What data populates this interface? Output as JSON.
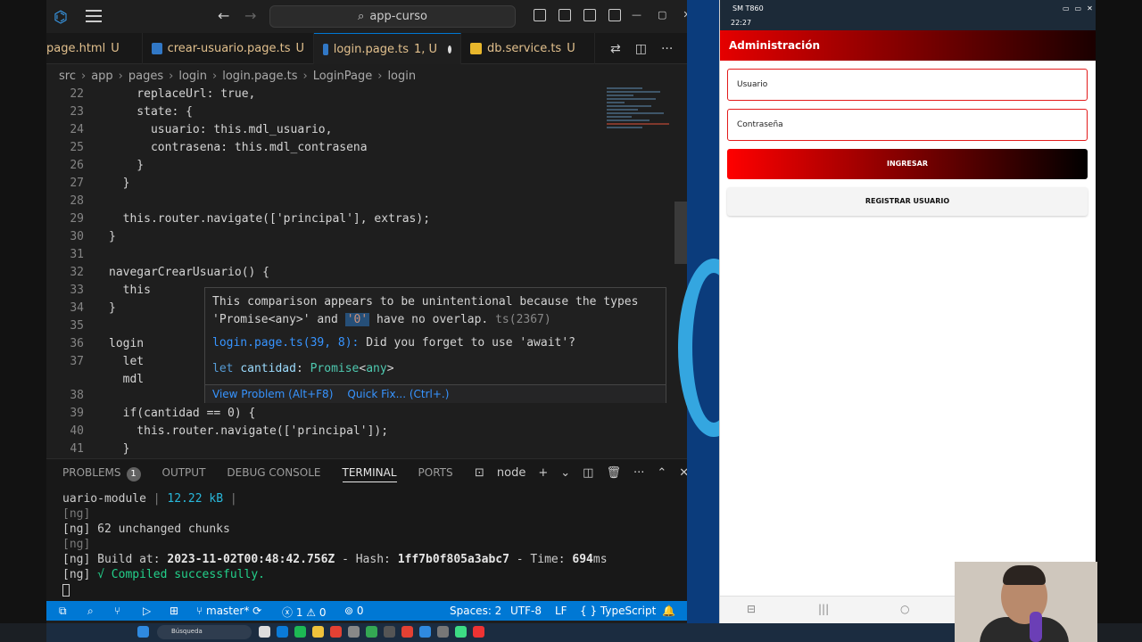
{
  "titlebar": {
    "search": "app-curso"
  },
  "tabs": [
    {
      "label": "page.html",
      "suffix": "U",
      "kind": "html"
    },
    {
      "label": "crear-usuario.page.ts",
      "suffix": "U",
      "kind": "ts"
    },
    {
      "label": "login.page.ts",
      "suffix": "1, U",
      "kind": "ts",
      "active": true
    },
    {
      "label": "db.service.ts",
      "suffix": "U",
      "kind": "ng"
    }
  ],
  "breadcrumb": [
    "src",
    "app",
    "pages",
    "login",
    "login.page.ts",
    "LoginPage",
    "login"
  ],
  "code_lines": [
    {
      "n": "22",
      "text": "    replaceUrl: true,"
    },
    {
      "n": "23",
      "text": "    state: {"
    },
    {
      "n": "24",
      "text": "      usuario: this.mdl_usuario,"
    },
    {
      "n": "25",
      "text": "      contrasena: this.mdl_contrasena"
    },
    {
      "n": "26",
      "text": "    }"
    },
    {
      "n": "27",
      "text": "  }"
    },
    {
      "n": "28",
      "text": ""
    },
    {
      "n": "29",
      "text": "  this.router.navigate(['principal'], extras);"
    },
    {
      "n": "30",
      "text": "}"
    },
    {
      "n": "31",
      "text": ""
    },
    {
      "n": "32",
      "text": "navegarCrearUsuario() {"
    },
    {
      "n": "33",
      "text": "  this"
    },
    {
      "n": "34",
      "text": "}"
    },
    {
      "n": "35",
      "text": ""
    },
    {
      "n": "36",
      "text": "login"
    },
    {
      "n": "37",
      "text": "  let"
    },
    {
      "n": "",
      "text": "  mdl"
    },
    {
      "n": "38",
      "text": ""
    },
    {
      "n": "39",
      "text": "  if(cantidad == 0) {"
    },
    {
      "n": "40",
      "text": "    this.router.navigate(['principal']);"
    },
    {
      "n": "41",
      "text": "  }"
    }
  ],
  "hover": {
    "line1": "This comparison appears to be unintentional because the types",
    "line2_a": "'Promise<any>' and ",
    "line2_hl": "'0'",
    "line2_b": " have no overlap.",
    "code": "ts(2367)",
    "related_link": "login.page.ts(39, 8):",
    "related_text": " Did you forget to use 'await'?",
    "signature": "let cantidad: Promise<any>",
    "view_problem": "View Problem (Alt+F8)",
    "quick_fix": "Quick Fix... (Ctrl+.)"
  },
  "panel": {
    "tabs": [
      "PROBLEMS",
      "OUTPUT",
      "DEBUG CONSOLE",
      "TERMINAL",
      "PORTS"
    ],
    "problems_count": "1",
    "terminal_name": "node",
    "lines": {
      "l1_a": "uario-module",
      "l1_sep": " | ",
      "l1_size": "12.22 kB",
      "l1_end": " |",
      "l2": "[ng]",
      "l3": "[ng] 62 unchanged chunks",
      "l4": "[ng]",
      "l5_a": "[ng] Build at: ",
      "l5_date": "2023-11-02T00:48:42.756Z",
      "l5_b": " - Hash: ",
      "l5_hash": "1ff7b0f805a3abc7",
      "l5_c": " - Time: ",
      "l5_time": "694",
      "l5_unit": "ms",
      "l6_a": "[ng] ",
      "l6_b": "√ Compiled successfully."
    }
  },
  "statusbar": {
    "branch": "master*",
    "errors": "1",
    "warnings": "0",
    "ports": "0",
    "spaces": "Spaces: 2",
    "encoding": "UTF-8",
    "eol": "LF",
    "language": "TypeScript"
  },
  "phone": {
    "status_device": "SM T860",
    "status_time": "22:27",
    "title": "Administración",
    "user_placeholder": "Usuario",
    "pass_placeholder": "Contraseña",
    "login_button": "INGRESAR",
    "register_button": "REGISTRAR USUARIO"
  },
  "taskbar": {
    "search": "Búsqueda"
  }
}
